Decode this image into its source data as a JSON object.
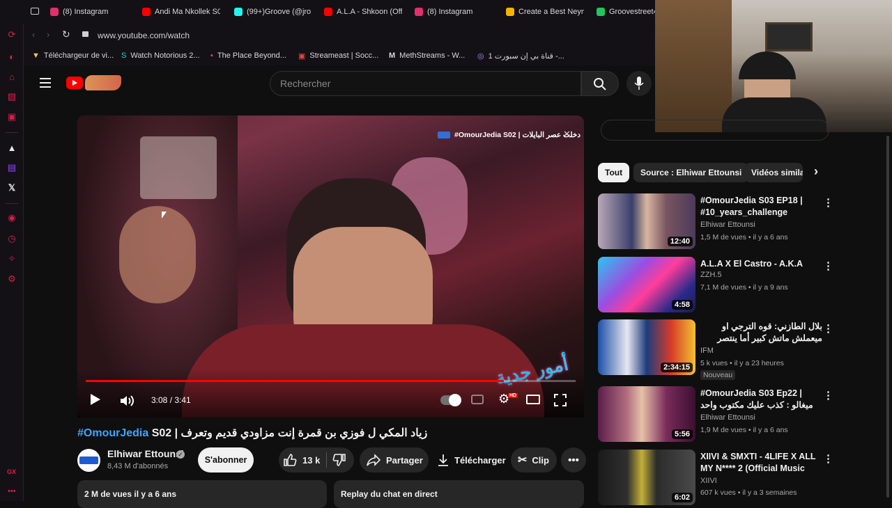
{
  "browser": {
    "tabs": [
      {
        "label": "(8) Instagram",
        "color": "#e1306c"
      },
      {
        "label": "Andi Ma Nkollek S0",
        "color": "#ff0000"
      },
      {
        "label": "(99+)Groove (@jro",
        "color": "#25f4ee"
      },
      {
        "label": "A.L.A - Shkoon (Off",
        "color": "#ff0000"
      },
      {
        "label": "(8) Instagram",
        "color": "#e1306c"
      },
      {
        "label": "Create a Best Neym",
        "color": "#f5b400"
      },
      {
        "label": "Groovestreet4",
        "color": "#22c55e"
      }
    ],
    "url": "www.youtube.com/watch",
    "bookmarks": [
      "Téléchargeur de vi...",
      "Watch Notorious 2...",
      "The Place Beyond...",
      "Streameast | Socc...",
      "MethStreams - W...",
      "قناة بي إن سبورت 1 -..."
    ],
    "bookmark_methstreams_letter": "M",
    "sidebar_bottom_label": "GX"
  },
  "youtube": {
    "search_placeholder": "Rechercher",
    "player": {
      "overlay_title": "#OmourJedia S02 | دخلت عصر البايلات",
      "time": "3:08 / 3:41",
      "progress": 0.853,
      "hd_badge": "HD",
      "watermark": "أمور جدية"
    },
    "video": {
      "title_hashtag": "#OmourJedia",
      "title_rest": " S02 | زياد المكي ل فوزي بن قمرة إنت مزاودي قديم وتعرف",
      "channel": "Elhiwar Ettounsi",
      "subscribers": "8,43 M d'abonnés",
      "subscribe_label": "S'abonner",
      "likes": "13 k",
      "share_label": "Partager",
      "download_label": "Télécharger",
      "clip_label": "Clip",
      "views_date": "2 M de vues  il y a 6 ans",
      "chat_replay": "Replay du chat en direct"
    },
    "chips": [
      "Tout",
      "Source : Elhiwar Ettounsi",
      "Vidéos simila"
    ],
    "recommendations": [
      {
        "title": "#OmourJedia S03 EP18 | #10_years_challenge",
        "channel": "Elhiwar Ettounsi",
        "verified": true,
        "meta": "1,5 M de vues • il y a 6 ans",
        "duration": "12:40",
        "badge": ""
      },
      {
        "title": "A.L.A X El Castro - A.K.A",
        "channel": "ZZH.5",
        "verified": true,
        "meta": "7,1 M de vues • il y a 9 ans",
        "duration": "4:58",
        "badge": ""
      },
      {
        "title": "بلال الطازني: قوه الترجي او ميعملش ماتش كبير أما ينتصر",
        "channel": "IFM",
        "verified": true,
        "meta": "5 k vues • il y a 23 heures",
        "duration": "2:34:15",
        "badge": "Nouveau"
      },
      {
        "title": "#OmourJedia S03 Ep22 | ميغالو : كذب عليك مكتوب واحد مازال فكره \" زياد",
        "channel": "Elhiwar Ettounsi",
        "verified": true,
        "meta": "1,9 M de vues • il y a 6 ans",
        "duration": "5:56",
        "badge": ""
      },
      {
        "title": "XIIVI & SMXTI - 4LIFE X ALL MY N**** 2 (Official Music Video)",
        "channel": "XIIVI",
        "verified": true,
        "meta": "607 k vues • il y a 3 semaines",
        "duration": "6:02",
        "badge": ""
      }
    ]
  },
  "colors": {
    "accent": "#ff0000",
    "opera": "#d6204c",
    "link": "#3ea6ff"
  }
}
